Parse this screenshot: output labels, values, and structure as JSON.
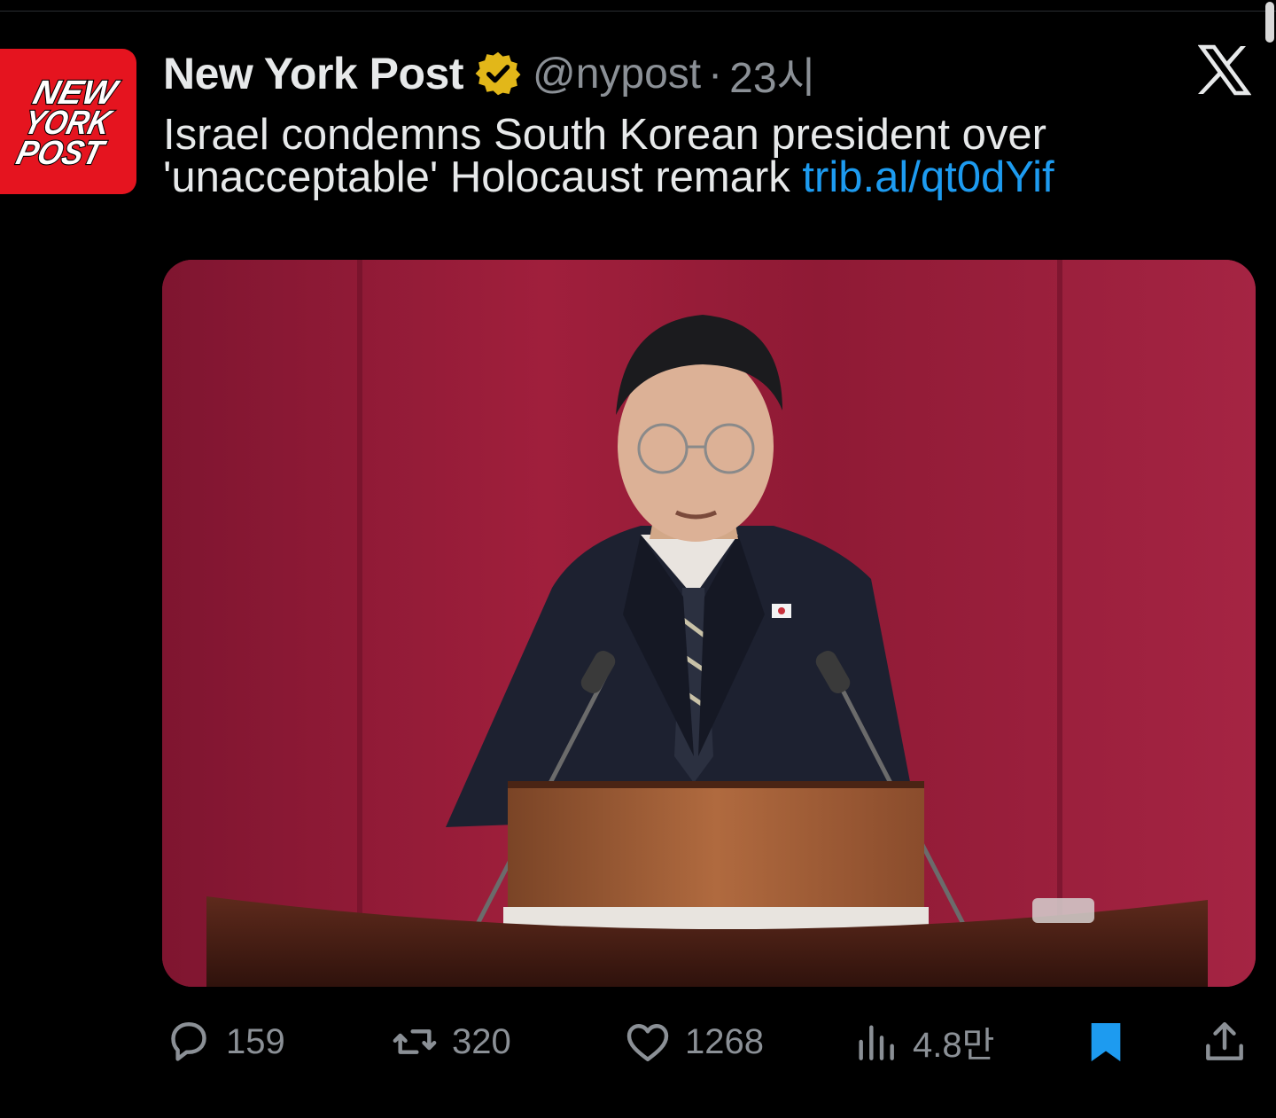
{
  "tweet": {
    "author_name": "New York Post",
    "handle": "@nypost",
    "separator": "·",
    "time": "23시",
    "text": "Israel condemns South Korean president over 'unacceptable' Holocaust remark ",
    "link_text": "trib.al/qt0dYif",
    "avatar_logo_lines": [
      "NEW",
      "YORK",
      "POST"
    ],
    "media_icon": "photo-politician-at-lectern",
    "verified_icon": "verified-gold-badge-icon",
    "platform_icon": "x-logo-icon"
  },
  "actions": {
    "replies": {
      "icon": "reply-icon",
      "count": "159"
    },
    "reposts": {
      "icon": "repost-icon",
      "count": "320"
    },
    "likes": {
      "icon": "heart-icon",
      "count": "1268"
    },
    "views": {
      "icon": "views-chart-icon",
      "count": "4.8만"
    },
    "bookmark": {
      "icon": "bookmark-filled-icon",
      "active": true
    },
    "share": {
      "icon": "share-upload-icon"
    }
  },
  "colors": {
    "background": "#000000",
    "text": "#e7e9ea",
    "secondary": "#8b9096",
    "link": "#1d9bf0",
    "brand_red": "#e5141f",
    "verified_gold": "#e2b719",
    "bookmark_blue": "#1d9bf0"
  }
}
